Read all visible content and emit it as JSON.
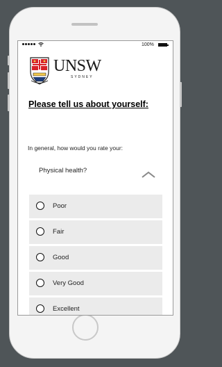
{
  "status_bar": {
    "battery_percent": "100%",
    "signal_icon": "signal-dots-icon",
    "wifi_icon": "wifi-icon",
    "battery_icon": "battery-icon"
  },
  "logo": {
    "name": "UNSW",
    "city": "SYDNEY"
  },
  "page": {
    "heading": "Please tell us about yourself:"
  },
  "question": {
    "prompt": "In general, how would you rate your:"
  },
  "accordion": {
    "title": "Physical health?",
    "expanded": true,
    "icon": "chevron-up-icon"
  },
  "options": [
    {
      "label": "Poor",
      "selected": false
    },
    {
      "label": "Fair",
      "selected": false
    },
    {
      "label": "Good",
      "selected": false
    },
    {
      "label": "Very Good",
      "selected": false
    },
    {
      "label": "Excellent",
      "selected": false
    }
  ],
  "colors": {
    "background": "#4f5558",
    "phone_body": "#f4f4f4",
    "option_bg": "#ebebeb",
    "crest_red": "#d8232a"
  }
}
